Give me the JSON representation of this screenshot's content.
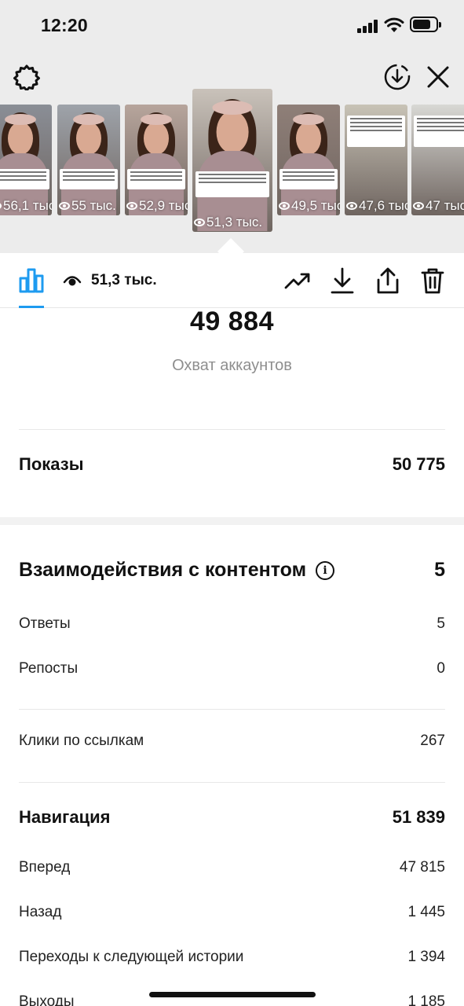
{
  "status_bar": {
    "time": "12:20"
  },
  "toolbar": {
    "settings_icon": "gear-icon",
    "download_circle_icon": "download-circle-icon",
    "close_icon": "close-icon"
  },
  "thumbnails": [
    {
      "views": "56,1 тыс.",
      "selected": false
    },
    {
      "views": "55 тыс.",
      "selected": false
    },
    {
      "views": "52,9 тыс.",
      "selected": false
    },
    {
      "views": "51,3 тыс.",
      "selected": true
    },
    {
      "views": "49,5 тыс.",
      "selected": false
    },
    {
      "views": "47,6 тыс.",
      "selected": false
    },
    {
      "views": "47 тыс.",
      "selected": false
    }
  ],
  "tabbar": {
    "insights_icon": "bar-chart-icon",
    "views_icon": "eye-icon",
    "views": "51,3 тыс.",
    "actions": [
      "trending-icon",
      "download-icon",
      "share-icon",
      "trash-icon"
    ]
  },
  "reach": {
    "value": "49 884",
    "label": "Охват аккаунтов"
  },
  "impressions": {
    "label": "Показы",
    "value": "50 775"
  },
  "interactions": {
    "title": "Взаимодействия с контентом",
    "total": "5",
    "rows": [
      {
        "label": "Ответы",
        "value": "5"
      },
      {
        "label": "Репосты",
        "value": "0"
      }
    ],
    "link_clicks": {
      "label": "Клики по ссылкам",
      "value": "267"
    }
  },
  "navigation": {
    "title": "Навигация",
    "total": "51 839",
    "rows": [
      {
        "label": "Вперед",
        "value": "47 815"
      },
      {
        "label": "Назад",
        "value": "1 445"
      },
      {
        "label": "Переходы к следующей истории",
        "value": "1 394"
      },
      {
        "label": "Выходы",
        "value": "1 185"
      }
    ]
  },
  "colors": {
    "accent": "#1e9bf0",
    "top_background": "#ececec",
    "muted_text": "#8e8e8e"
  }
}
